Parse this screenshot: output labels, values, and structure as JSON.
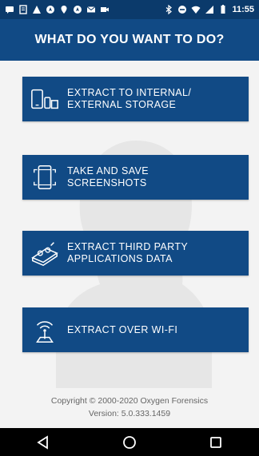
{
  "status_bar": {
    "time": "11:55",
    "left_icons": [
      "message-icon",
      "notes-icon",
      "alert-icon",
      "navigation-icon",
      "location-icon",
      "navigation-icon",
      "gmail-icon",
      "video-icon"
    ],
    "right_icons": [
      "bluetooth-icon",
      "do-not-disturb-icon",
      "wifi-icon",
      "signal-icon",
      "battery-icon"
    ]
  },
  "header": {
    "title": "WHAT DO YOU WANT TO DO?"
  },
  "actions": [
    {
      "label": "EXTRACT TO INTERNAL/\nEXTERNAL STORAGE",
      "icon": "storage-devices-icon"
    },
    {
      "label": "TAKE AND SAVE\nSCREENSHOTS",
      "icon": "phone-screenshot-icon"
    },
    {
      "label": "EXTRACT THIRD PARTY\nAPPLICATIONS DATA",
      "icon": "apps-data-icon"
    },
    {
      "label": "EXTRACT OVER WI-FI",
      "icon": "wifi-tower-icon"
    }
  ],
  "footer": {
    "copyright": "Copyright © 2000-2020 Oxygen Forensics",
    "version": "Version: 5.0.333.1459"
  },
  "nav": {
    "icons": [
      "back-icon",
      "home-icon",
      "recents-icon"
    ]
  },
  "colors": {
    "status_bar": "#0b3a6b",
    "primary": "#114a85",
    "background": "#f3f3f3"
  }
}
